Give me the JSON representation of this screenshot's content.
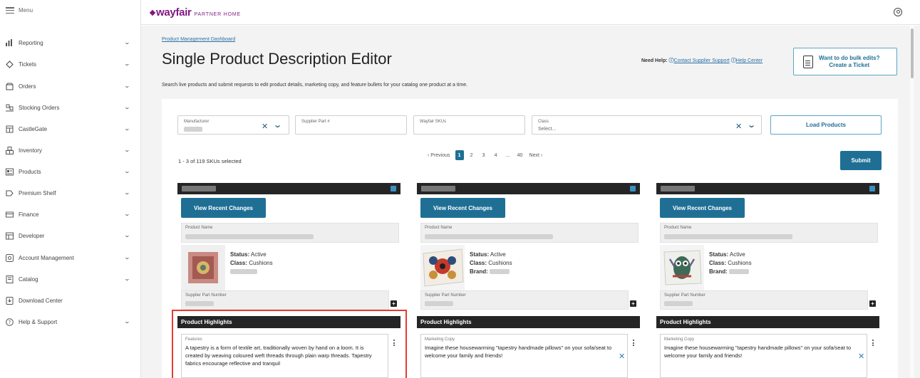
{
  "sidebar": {
    "menu_label": "Menu",
    "items": [
      {
        "label": "Reporting",
        "icon": "bar-chart-icon"
      },
      {
        "label": "Tickets",
        "icon": "tag-icon"
      },
      {
        "label": "Orders",
        "icon": "box-icon"
      },
      {
        "label": "Stocking Orders",
        "icon": "pallet-icon"
      },
      {
        "label": "CastleGate",
        "icon": "warehouse-icon"
      },
      {
        "label": "Inventory",
        "icon": "boxes-icon"
      },
      {
        "label": "Products",
        "icon": "product-icon"
      },
      {
        "label": "Premium Shelf",
        "icon": "label-icon"
      },
      {
        "label": "Finance",
        "icon": "card-icon"
      },
      {
        "label": "Developer",
        "icon": "code-icon"
      },
      {
        "label": "Account Management",
        "icon": "gear-icon"
      },
      {
        "label": "Catalog",
        "icon": "catalog-icon"
      },
      {
        "label": "Download Center",
        "icon": "download-icon"
      },
      {
        "label": "Help & Support",
        "icon": "help-icon"
      }
    ]
  },
  "topbar": {
    "brand": "wayfair",
    "brand_sub": "PARTNER HOME",
    "brand_color": "#7f187f"
  },
  "page": {
    "breadcrumb": "Product Management Dashboard",
    "title": "Single Product Description Editor",
    "description": "Search live products and submit requests to edit product details, marketing copy, and feature bullets for your catalog one product at a time.",
    "help_label": "Need Help:",
    "help_link_support": "Contact Supplier Support",
    "help_link_center": "Help Center",
    "bulk_line1": "Want to do bulk edits?",
    "bulk_line2": "Create a Ticket"
  },
  "filters": {
    "manufacturer_label": "Manufacturer",
    "supplier_part_label": "Supplier Part #",
    "wayfair_skus_label": "Wayfair SKUs",
    "class_label": "Class",
    "class_placeholder": "Select...",
    "load_button": "Load Products"
  },
  "results": {
    "selected_text": "1 - 3 of 119 SKUs selected",
    "pager": [
      "‹ Previous",
      "1",
      "2",
      "3",
      "4",
      "...",
      "40",
      "Next ›"
    ],
    "current_page": "1",
    "submit": "Submit"
  },
  "cards": [
    {
      "view_button": "View Recent Changes",
      "product_name_label": "Product Name",
      "status": "Active",
      "class": "Cushions",
      "brand_label": "",
      "supplier_part_label": "Supplier Part Number",
      "highlights_title": "Product Highlights",
      "field_label": "Features",
      "field_text": "A tapestry is a form of textile art, traditionally woven by hand on a loom. It is created by weaving coloured weft threads through plain warp threads.  Tapestry fabrics encourage reflective and tranquil"
    },
    {
      "view_button": "View Recent Changes",
      "product_name_label": "Product Name",
      "status": "Active",
      "class": "Cushions",
      "brand_label": "Brand:",
      "supplier_part_label": "Supplier Part Number",
      "highlights_title": "Product Highlights",
      "field_label": "Marketing Copy",
      "field_text": "Imagine these housewarming \"tapestry handmade pillows\" on your sofa/seat to welcome your family and friends!"
    },
    {
      "view_button": "View Recent Changes",
      "product_name_label": "Product Name",
      "status": "Active",
      "class": "Cushions",
      "brand_label": "Brand:",
      "supplier_part_label": "Supplier Part Number",
      "highlights_title": "Product Highlights",
      "field_label": "Marketing Copy",
      "field_text": "Imagine these housewarming \"tapestry handmade pillows\" on your sofa/seat to welcome your family and friends!"
    }
  ],
  "labels": {
    "status": "Status:",
    "class": "Class:"
  },
  "colors": {
    "primary_button": "#1f6f95",
    "highlight_frame": "#e53b2f",
    "dark_header": "#252525"
  }
}
